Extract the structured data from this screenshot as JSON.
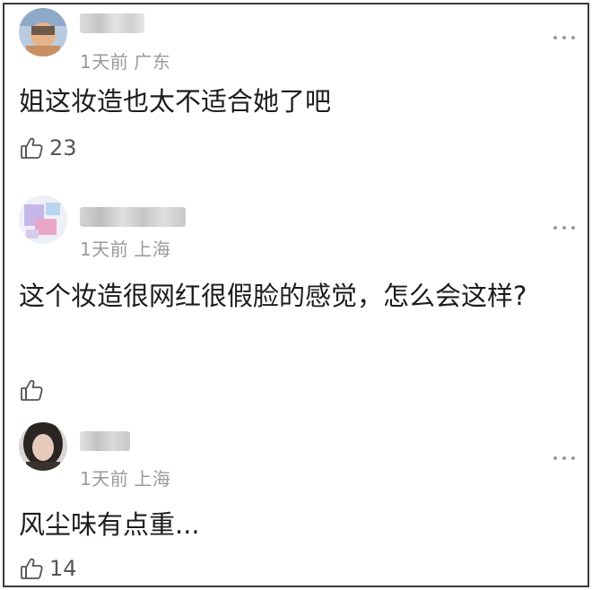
{
  "comments": [
    {
      "time": "1天前",
      "location": "广东",
      "text": "姐这妆造也太不适合她了吧",
      "likes": "23"
    },
    {
      "time": "1天前",
      "location": "上海",
      "text": "这个妆造很网红很假脸的感觉，怎么会这样?",
      "likes": ""
    },
    {
      "time": "1天前",
      "location": "上海",
      "text": "风尘味有点重...",
      "likes": "14"
    }
  ],
  "icons": {
    "like": "thumbs-up-outline-icon",
    "more": "more-horizontal-icon"
  }
}
